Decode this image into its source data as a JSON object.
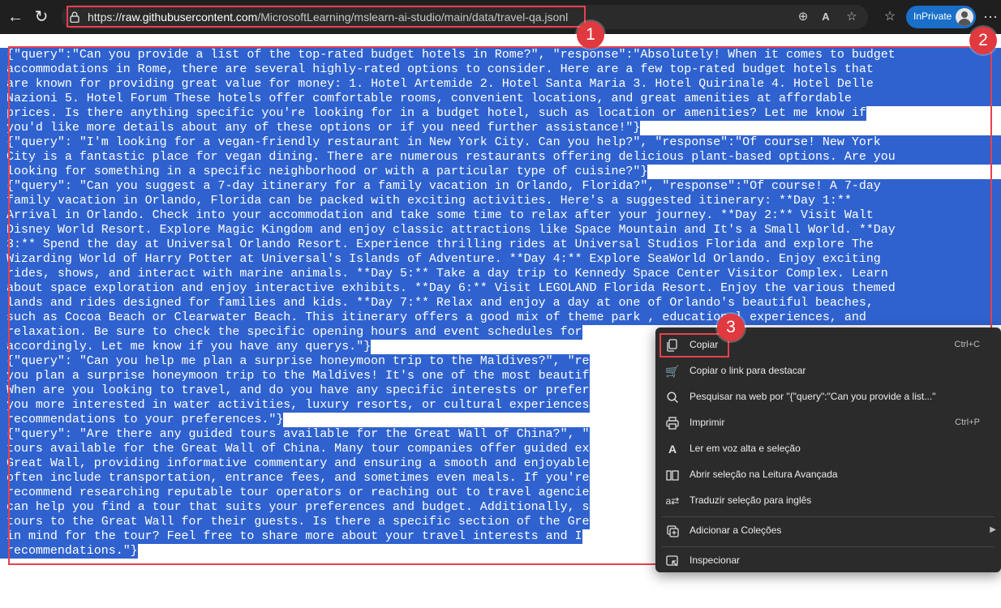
{
  "browser": {
    "url_prefix": "https://",
    "url_host": "raw.githubusercontent.com",
    "url_path": "/MicrosoftLearning/mslearn-ai-studio/main/data/travel-qa.jsonl",
    "inprivate_label": "InPrivate",
    "icons": [
      "back-icon",
      "refresh-icon",
      "lock-icon",
      "zoom-icon",
      "read-aloud-icon",
      "favorite-icon",
      "favorites-bar-icon",
      "profile-avatar",
      "more-icon"
    ]
  },
  "content": {
    "lines": [
      "{\"query\":\"Can you provide a list of the top-rated budget hotels in Rome?\", \"response\":\"Absolutely! When it comes to budget",
      "accommodations in Rome, there are several highly-rated options to consider. Here are a few top-rated budget hotels that",
      "are known for providing great value for money: 1. Hotel Artemide 2. Hotel Santa Maria 3. Hotel Quirinale 4. Hotel Delle",
      "Nazioni 5. Hotel Forum These hotels offer comfortable rooms, convenient locations, and great amenities at affordable",
      "prices. Is there anything specific you're looking for in a budget hotel, such as location or amenities? Let me know if",
      "you'd like more details about any of these options or if you need further assistance!\"}",
      "{\"query\": \"I'm looking for a vegan-friendly restaurant in New York City. Can you help?\", \"response\":\"Of course! New York",
      "City is a fantastic place for vegan dining. There are numerous restaurants offering delicious plant-based options. Are you",
      "looking for something in a specific neighborhood or with a particular type of cuisine?\"}",
      "{\"query\": \"Can you suggest a 7-day itinerary for a family vacation in Orlando, Florida?\", \"response\":\"Of course! A 7-day",
      "family vacation in Orlando, Florida can be packed with exciting activities. Here's a suggested itinerary: **Day 1:**",
      "Arrival in Orlando. Check into your accommodation and take some time to relax after your journey. **Day 2:** Visit Walt",
      "Disney World Resort. Explore Magic Kingdom and enjoy classic attractions like Space Mountain and It's a Small World. **Day",
      "3:** Spend the day at Universal Orlando Resort. Experience thrilling rides at Universal Studios Florida and explore The",
      "Wizarding World of Harry Potter at Universal's Islands of Adventure. **Day 4:** Explore SeaWorld Orlando. Enjoy exciting",
      "rides, shows, and interact with marine animals. **Day 5:** Take a day trip to Kennedy Space Center Visitor Complex. Learn",
      "about space exploration and enjoy interactive exhibits. **Day 6:** Visit LEGOLAND Florida Resort. Enjoy the various themed",
      "lands and rides designed for families and kids. **Day 7:** Relax and enjoy a day at one of Orlando's beautiful beaches,",
      "such as Cocoa Beach or Clearwater Beach. This itinerary offers a good mix of theme park , educational experiences, and",
      "relaxation. Be sure to check the specific opening hours and event schedules for",
      "accordingly. Let me know if you have any querys.\"}",
      "{\"query\": \"Can you help me plan a surprise honeymoon trip to the Maldives?\", \"re",
      "you plan a surprise honeymoon trip to the Maldives! It's one of the most beautif",
      "When are you looking to travel, and do you have any specific interests or prefer",
      "you more interested in water activities, luxury resorts, or cultural experiences",
      "recommendations to your preferences.\"}",
      "{\"query\": \"Are there any guided tours available for the Great Wall of China?\", \"",
      "tours available for the Great Wall of China. Many tour companies offer guided ex",
      "Great Wall, providing informative commentary and ensuring a smooth and enjoyable",
      "often include transportation, entrance fees, and sometimes even meals. If you're",
      "recommend researching reputable tour operators or reaching out to travel agencie",
      "can help you find a tour that suits your preferences and budget. Additionally, s",
      "tours to the Great Wall for their guests. Is there a specific section of the Gre",
      "in mind for the tour? Feel free to share more about your travel interests and I",
      "recommendations.\"}"
    ]
  },
  "annotations": {
    "badge_1": "1",
    "badge_2": "2",
    "badge_3": "3"
  },
  "context_menu": {
    "items": [
      {
        "icon": "copy-icon",
        "label": "Copiar",
        "shortcut": "Ctrl+C"
      },
      {
        "icon": "link-highlight-icon",
        "label": "Copiar o link para destacar",
        "shortcut": ""
      },
      {
        "icon": "search-icon",
        "label": "Pesquisar na web por \"{\"query\":\"Can you provide a list...\"",
        "shortcut": ""
      },
      {
        "icon": "print-icon",
        "label": "Imprimir",
        "shortcut": "Ctrl+P"
      },
      {
        "icon": "read-aloud-icon",
        "label": "Ler em voz alta e seleção",
        "shortcut": ""
      },
      {
        "icon": "immersive-reader-icon",
        "label": "Abrir seleção na Leitura Avançada",
        "shortcut": ""
      },
      {
        "icon": "translate-icon",
        "label": "Traduzir seleção para inglês",
        "shortcut": ""
      },
      {
        "icon": "collections-icon",
        "label": "Adicionar a Coleções",
        "shortcut": ""
      },
      {
        "icon": "inspect-icon",
        "label": "Inspecionar",
        "shortcut": ""
      }
    ]
  },
  "colors": {
    "selection": "#2f62cf",
    "annotation_red": "#e8414b",
    "toolbar": "#1f1f1f",
    "menu": "#2b2b2b",
    "inprivate": "#1a6fc9"
  }
}
